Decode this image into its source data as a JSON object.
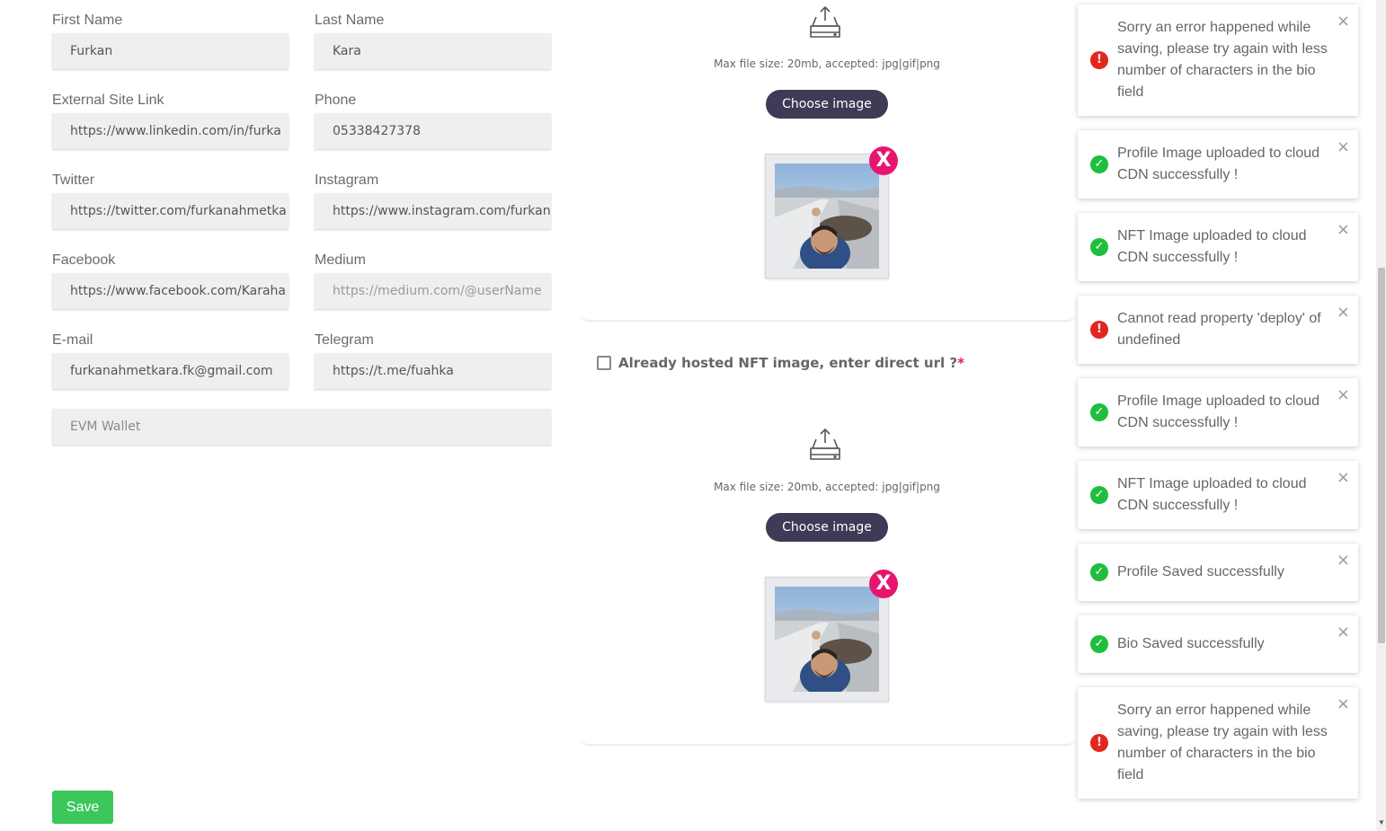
{
  "form": {
    "fields": [
      {
        "label": "First Name",
        "value": "Furkan",
        "placeholder": ""
      },
      {
        "label": "Last Name",
        "value": "Kara",
        "placeholder": ""
      },
      {
        "label": "External Site Link",
        "value": "https://www.linkedin.com/in/furka",
        "placeholder": ""
      },
      {
        "label": "Phone",
        "value": "05338427378",
        "placeholder": ""
      },
      {
        "label": "Twitter",
        "value": "https://twitter.com/furkanahmetka",
        "placeholder": ""
      },
      {
        "label": "Instagram",
        "value": "https://www.instagram.com/furkan",
        "placeholder": ""
      },
      {
        "label": "Facebook",
        "value": "https://www.facebook.com/Karaha",
        "placeholder": ""
      },
      {
        "label": "Medium",
        "value": "",
        "placeholder": "https://medium.com/@userName"
      },
      {
        "label": "E-mail",
        "value": "furkanahmetkara.fk@gmail.com",
        "placeholder": ""
      },
      {
        "label": "Telegram",
        "value": "https://t.me/fuahka",
        "placeholder": ""
      }
    ],
    "wallet_placeholder": "EVM Wallet",
    "save_label": "Save"
  },
  "profile_upload": {
    "max_size_text": "Max file size: 20mb, accepted: jpg|gif|png",
    "choose_label": "Choose image",
    "remove_label": "X"
  },
  "nft_upload": {
    "hosted_label": "Already hosted NFT image, enter direct url ?",
    "required_mark": "*",
    "max_size_text": "Max file size: 20mb, accepted: jpg|gif|png",
    "choose_label": "Choose image",
    "remove_label": "X"
  },
  "toasts": [
    {
      "type": "error",
      "message": "Sorry an error happened while saving, please try again with less number of characters in the bio field"
    },
    {
      "type": "success",
      "message": "Profile Image uploaded to cloud CDN successfully !"
    },
    {
      "type": "success",
      "message": "NFT Image uploaded to cloud CDN successfully !"
    },
    {
      "type": "error",
      "message": "Cannot read property 'deploy' of undefined"
    },
    {
      "type": "success",
      "message": "Profile Image uploaded to cloud CDN successfully !"
    },
    {
      "type": "success",
      "message": "NFT Image uploaded to cloud CDN successfully !"
    },
    {
      "type": "success",
      "message": "Profile Saved successfully"
    },
    {
      "type": "success",
      "message": "Bio Saved successfully"
    },
    {
      "type": "error",
      "message": "Sorry an error happened while saving, please try again with less number of characters in the bio field"
    }
  ],
  "toast_close": "×",
  "icons": {
    "success": "check-circle-icon",
    "error": "exclamation-circle-icon",
    "upload": "upload-tray-icon"
  },
  "colors": {
    "save_button": "#3bc75a",
    "choose_button": "#3f3a55",
    "remove_badge": "#e8156f",
    "success": "#1fbe3f",
    "error": "#e3261f"
  }
}
